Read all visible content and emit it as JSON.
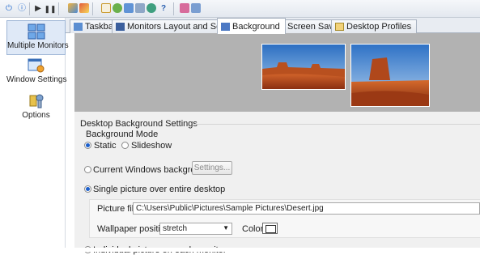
{
  "toolbar": {
    "icons": [
      "power-icon",
      "info-icon",
      "play-icon",
      "pause-icon",
      "layout-icon",
      "layout-alt-icon",
      "window-icon",
      "check-icon",
      "display-icon",
      "grid-icon",
      "refresh-icon",
      "help-icon",
      "pointer-icon",
      "taskbar-icon"
    ]
  },
  "sidebar": {
    "items": [
      {
        "label": "Multiple Monitors",
        "icon": "monitors-icon",
        "selected": true
      },
      {
        "label": "Window Settings",
        "icon": "window-settings-icon",
        "selected": false
      },
      {
        "label": "Options",
        "icon": "options-icon",
        "selected": false
      }
    ]
  },
  "tabs": [
    {
      "label": "Taskbar",
      "icon": "taskbar-icon",
      "active": false
    },
    {
      "label": "Monitors Layout and Settings",
      "icon": "monitor-layout-icon",
      "active": false
    },
    {
      "label": "Background",
      "icon": "background-icon",
      "active": true
    },
    {
      "label": "Screen Saver",
      "icon": "screensaver-icon",
      "active": false
    },
    {
      "label": "Desktop Profiles",
      "icon": "profiles-icon",
      "active": false
    }
  ],
  "settings": {
    "group_title": "Desktop Background Settings",
    "background_mode_label": "Background Mode",
    "mode_static": "Static",
    "mode_slideshow": "Slideshow",
    "mode_selected": "Static",
    "current_windows_background": "Current Windows background",
    "settings_button": "Settings...",
    "single_picture": "Single picture over entire desktop",
    "source_selected": "Single picture over entire desktop",
    "picture_file_label": "Picture file:",
    "picture_file_value": "C:\\Users\\Public\\Pictures\\Sample Pictures\\Desert.jpg",
    "wallpaper_position_label": "Wallpaper position:",
    "wallpaper_position_value": "stretch",
    "color_label": "Color:",
    "individual_picture": "Individual picture on each monitor"
  },
  "colors": {
    "accent": "#1b5fcc",
    "preview_bg": "#b2b2b2",
    "panel_bg": "#f0f0f0",
    "selected_item_bg": "#dfe9f7"
  }
}
